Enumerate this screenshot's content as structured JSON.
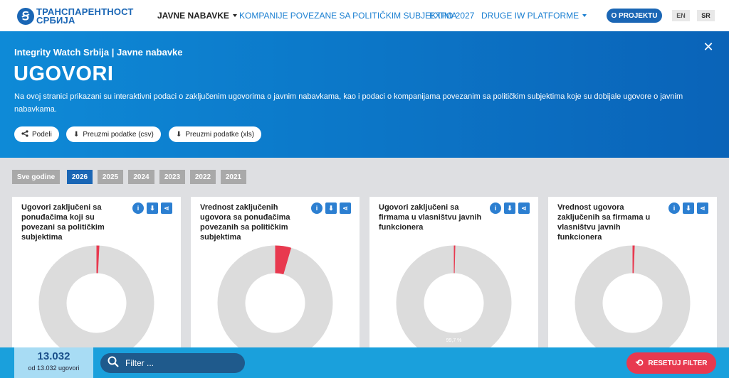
{
  "nav": {
    "logo_line1": "ТРАНСПАРЕНТНОСТ",
    "logo_line2": "СРБИЈА",
    "items": [
      {
        "label": "JAVNE NABAVKE",
        "active": true,
        "dropdown": true
      },
      {
        "label": "KOMPANIJE POVEZANE SA POLITIČKIM SUBJEKTIMA",
        "active": false,
        "dropdown": false
      },
      {
        "label": "EXPO 2027",
        "active": false,
        "dropdown": false
      },
      {
        "label": "DRUGE IW PLATFORME",
        "active": false,
        "dropdown": true
      }
    ],
    "project_button": "O PROJEKTU",
    "languages": [
      {
        "label": "EN",
        "selected": false
      },
      {
        "label": "SR",
        "selected": true
      }
    ]
  },
  "hero": {
    "subtitle": "Integrity Watch Srbija | Javne nabavke",
    "title": "UGOVORI",
    "description": "Na ovoj stranici prikazani su interaktivni podaci o zaključenim ugovorima o javnim nabavkama, kao i podaci o kompanijama povezanim sa političkim subjektima koje su dobijale ugovore o javnim nabavkama.",
    "close_icon": "close-icon",
    "buttons": [
      {
        "label": "Podeli",
        "icon": "share-icon"
      },
      {
        "label": "Preuzmi podatke (csv)",
        "icon": "download-icon"
      },
      {
        "label": "Preuzmi podatke (xls)",
        "icon": "download-icon"
      }
    ]
  },
  "years": [
    {
      "label": "Sve godine",
      "selected": false
    },
    {
      "label": "2026",
      "selected": true
    },
    {
      "label": "2025",
      "selected": false
    },
    {
      "label": "2024",
      "selected": false
    },
    {
      "label": "2023",
      "selected": false
    },
    {
      "label": "2022",
      "selected": false
    },
    {
      "label": "2021",
      "selected": false
    }
  ],
  "colors": {
    "accent": "#1a66b5",
    "highlight": "#e8394f",
    "donut_rest": "#dcdcdc",
    "footer": "#1aa0dc"
  },
  "cards": [
    {
      "title": "Ugovori zaključeni sa ponuđačima koji su povezani sa političkim subjektima",
      "highlight_fraction": 0.008,
      "percent_label": ""
    },
    {
      "title": "Vrednost zaključenih ugovora sa ponuđačima povezanih sa političkim subjektima",
      "highlight_fraction": 0.045,
      "percent_label": ""
    },
    {
      "title": "Ugovori zaključeni sa firmama u vlasništvu javnih funkcionera",
      "highlight_fraction": 0.004,
      "percent_label": "99,7 %"
    },
    {
      "title": "Vrednost ugovora zaključenih sa firmama u vlasništvu javnih funkcionera",
      "highlight_fraction": 0.006,
      "percent_label": ""
    }
  ],
  "card_tools": [
    "info-icon",
    "download-icon",
    "share-icon"
  ],
  "footer": {
    "count": "13.032",
    "count_of": "od 13.032 ugovori",
    "filter_placeholder": "Filter ...",
    "reset_label": "RESETUJ FILTER"
  }
}
